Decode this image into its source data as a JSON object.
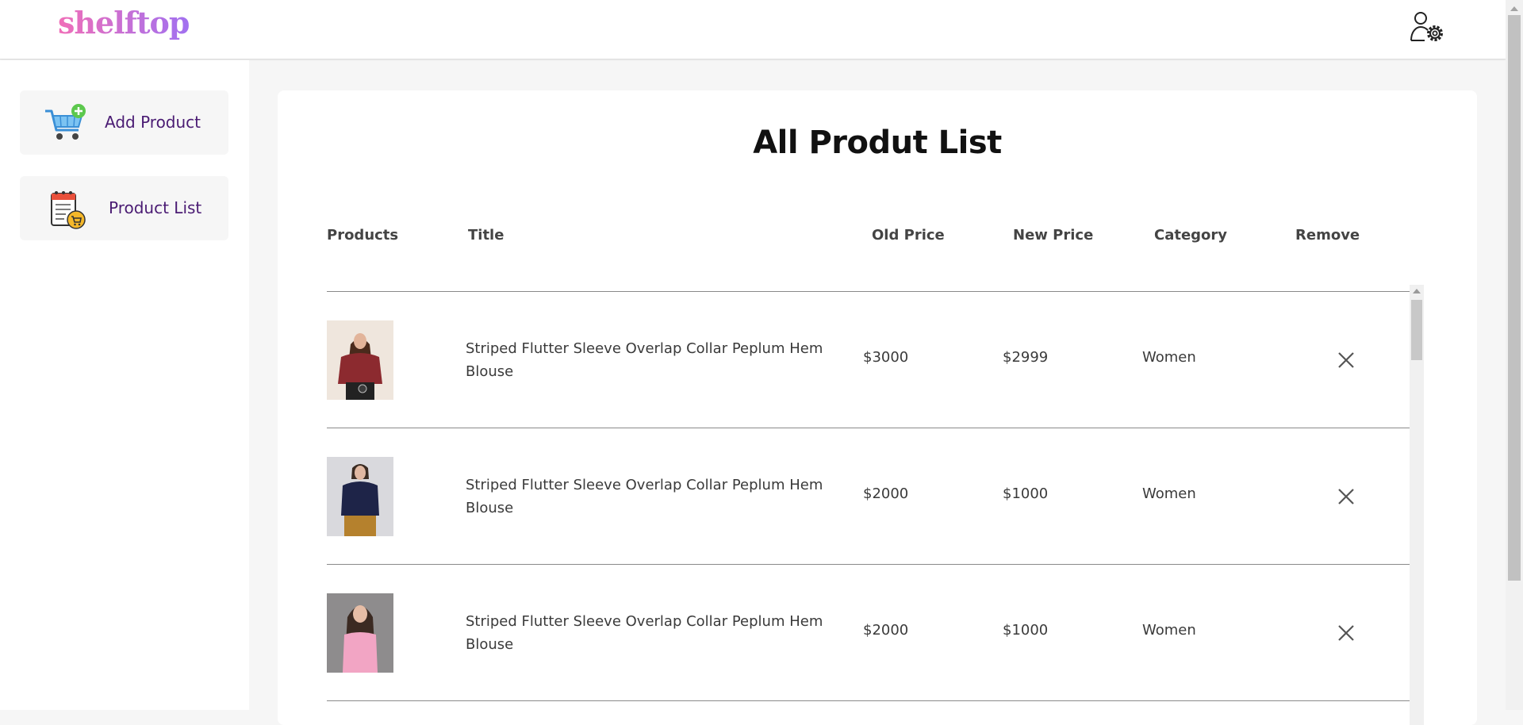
{
  "header": {
    "logo": "shelftop",
    "admin_icon": "admin-gear-icon",
    "logo_colors": [
      "#f06fb8",
      "#a170f0"
    ]
  },
  "sidebar": {
    "items": [
      {
        "label": "Add Product",
        "icon": "cart-add-icon"
      },
      {
        "label": "Product List",
        "icon": "list-cart-icon"
      }
    ]
  },
  "main": {
    "title": "All Produt List",
    "columns": [
      "Products",
      "Title",
      "Old Price",
      "New Price",
      "Category",
      "Remove"
    ],
    "rows": [
      {
        "image": "woman-maroon-top-thumbnail",
        "title": "Striped Flutter Sleeve Overlap Collar Peplum Hem Blouse",
        "old_price": "$3000",
        "new_price": "$2999",
        "category": "Women"
      },
      {
        "image": "woman-navy-sweater-thumbnail",
        "title": "Striped Flutter Sleeve Overlap Collar Peplum Hem Blouse",
        "old_price": "$2000",
        "new_price": "$1000",
        "category": "Women"
      },
      {
        "image": "woman-pink-top-thumbnail",
        "title": "Striped Flutter Sleeve Overlap Collar Peplum Hem Blouse",
        "old_price": "$2000",
        "new_price": "$1000",
        "category": "Women"
      }
    ]
  }
}
